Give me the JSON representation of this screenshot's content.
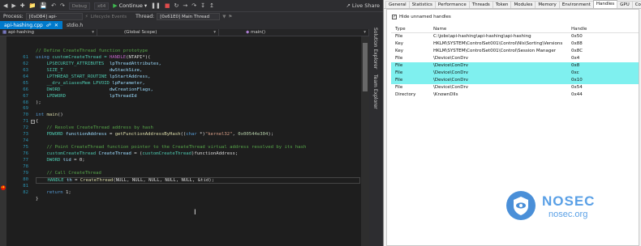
{
  "vs": {
    "toolbar": {
      "debug_label": "Debug",
      "platform_label": "x64",
      "continue_label": "Continue",
      "live_share_label": "Live Share"
    },
    "debugbar": {
      "process_label": "Process:",
      "process_value": "[0xD84] api-hashing.exe",
      "lifecycle_label": "Lifecycle Events",
      "thread_label": "Thread:",
      "thread_value": "[0x61E0] Main Thread"
    },
    "tabs": [
      {
        "label": "api-hashing.cpp",
        "active": true
      },
      {
        "label": "stdio.h",
        "active": false
      }
    ],
    "navbar": {
      "project": "api-hashing",
      "scope": "(Global Scope)",
      "member": "main()"
    },
    "side_tabs": [
      "Solution Explorer",
      "Team Explorer"
    ],
    "line_numbers": [
      "",
      "61",
      "62",
      "63",
      "64",
      "65",
      "66",
      "67",
      "68",
      "69",
      "70",
      "71",
      "72",
      "73",
      "74",
      "75",
      "76",
      "77",
      "78",
      "79",
      "80",
      "81",
      "82"
    ],
    "code": {
      "l60_comment": "// Define CreateThread function prototype",
      "l61_using": "using",
      "l61_name": " customCreateThread = ",
      "l61_macro": "HANDLE",
      "l61_rest": "(NTAPI*)(",
      "l62_type": "    LPSECURITY_ATTRIBUTES",
      "l62_param": "  lpThreadAttributes,",
      "l63_type": "    SIZE_T",
      "l63_param": "                 dwStackSize,",
      "l64_type": "    LPTHREAD_START_ROUTINE",
      "l64_param": " lpStartAddress,",
      "l65_type": "    __drv_aliasesMem LPVOID",
      "l65_param": " lpParameter,",
      "l66_type": "    DWORD",
      "l66_param": "                  dwCreationFlags,",
      "l67_type": "    LPDWORD",
      "l67_param": "                lpThreadId",
      "l68_close": ");",
      "l70_kw": "int",
      "l70_fn": " main",
      "l70_rest": "()",
      "l71_brace": "{",
      "l72_comment": "    // Resolve CreateThread address by hash",
      "l73_type": "    PDWORD",
      "l73_var": " functionAddress",
      "l73_eq": " = ",
      "l73_fn": "getFunctionAddressByHash",
      "l73_open": "((",
      "l73_kw": "char",
      "l73_cast": " *)",
      "l73_str": "\"kernel32\"",
      "l73_comma": ", ",
      "l73_num": "0x00544e304",
      "l73_end": ");",
      "l75_comment": "    // Point CreateThread function pointer to the CreateThread virtual address resolved by its hash",
      "l76_type": "    customCreateThread",
      "l76_var": " CreateThread",
      "l76_eq": " = (",
      "l76_cast": "customCreateThread",
      "l76_end": ")functionAddress;",
      "l77_type": "    DWORD",
      "l77_var": " tid",
      "l77_end": " = 0;",
      "l79_comment": "    // Call CreateThread",
      "l80_type": "    HANDLE",
      "l80_var": " th",
      "l80_eq": " = ",
      "l80_fn": "CreateThread",
      "l80_rest": "(NULL, NULL, NULL, NULL, NULL, &tid);",
      "l82_kw": "    return",
      "l82_rest": " 1;",
      "l83_brace": "}"
    }
  },
  "pe": {
    "tabs": [
      "General",
      "Statistics",
      "Performance",
      "Threads",
      "Token",
      "Modules",
      "Memory",
      "Environment",
      "Handles",
      "GPU",
      "Comment"
    ],
    "active_tab": "Handles",
    "hide_unnamed_label": "Hide unnamed handles",
    "hide_unnamed_checked": true,
    "columns": [
      "Type",
      "Name",
      "Handle"
    ],
    "rows": [
      {
        "type": "File",
        "name": "C:\\jobs\\api-hashing\\api-hashing\\api-hashing",
        "handle": "0x50",
        "selected": false
      },
      {
        "type": "Key",
        "name": "HKLM\\SYSTEM\\ControlSet001\\Control\\Nls\\Sorting\\Versions",
        "handle": "0x88",
        "selected": false
      },
      {
        "type": "Key",
        "name": "HKLM\\SYSTEM\\ControlSet001\\Control\\Session Manager",
        "handle": "0x8C",
        "selected": false
      },
      {
        "type": "File",
        "name": "\\Device\\ConDrv",
        "handle": "0x4",
        "selected": false
      },
      {
        "type": "File",
        "name": "\\Device\\ConDrv",
        "handle": "0x8",
        "selected": true
      },
      {
        "type": "File",
        "name": "\\Device\\ConDrv",
        "handle": "0xc",
        "selected": true
      },
      {
        "type": "File",
        "name": "\\Device\\ConDrv",
        "handle": "0x10",
        "selected": true
      },
      {
        "type": "File",
        "name": "\\Device\\ConDrv",
        "handle": "0x54",
        "selected": false
      },
      {
        "type": "Directory",
        "name": "\\KnownDlls",
        "handle": "0x44",
        "selected": false
      }
    ]
  },
  "watermark": {
    "title": "NOSEC",
    "subtitle": "nosec.org",
    "color": "#5aa0e6"
  },
  "colors": {
    "vs_accent": "#007acc",
    "selection": "#7ff0ef",
    "breakpoint": "#e51400"
  }
}
